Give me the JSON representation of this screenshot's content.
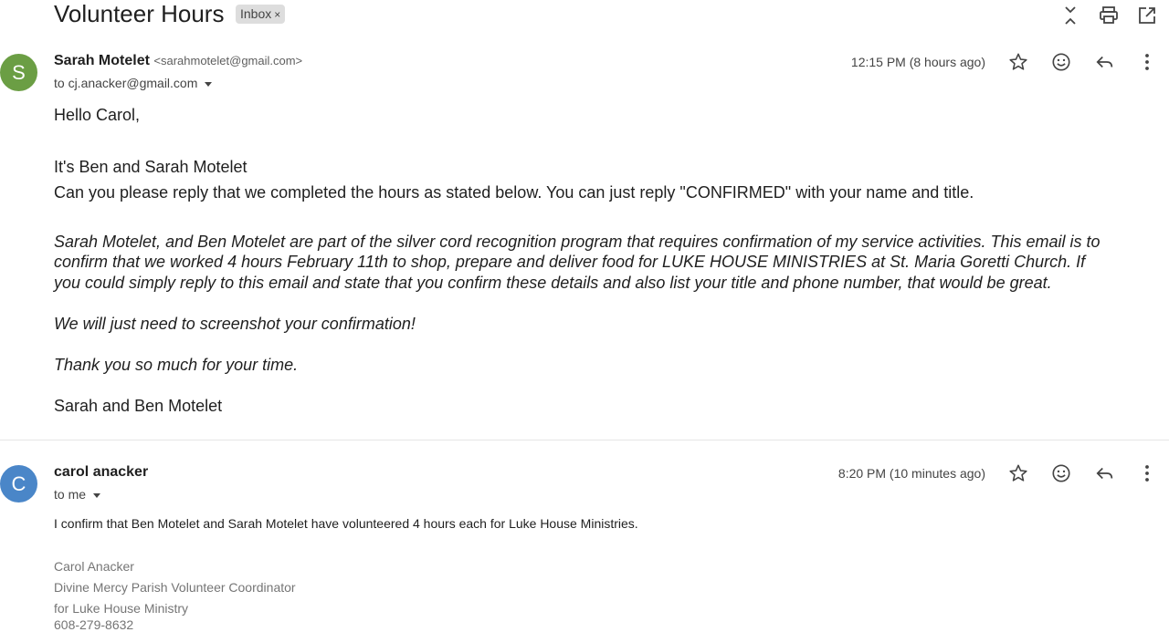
{
  "thread": {
    "subject": "Volunteer Hours",
    "label": "Inbox",
    "label_remove": "×"
  },
  "top_actions": [
    {
      "name": "collapse-all-icon"
    },
    {
      "name": "print-icon"
    },
    {
      "name": "open-in-new-window-icon"
    }
  ],
  "messages": [
    {
      "avatar_letter": "S",
      "avatar_color": "#6b9e44",
      "sender_name": "Sarah Motelet",
      "sender_email": "<sarahmotelet@gmail.com>",
      "to": "to cj.anacker@gmail.com",
      "timestamp": "12:15 PM (8 hours ago)",
      "greeting": "Hello Carol,",
      "line1": "It's Ben and Sarah Motelet",
      "line2": "Can you please reply that we completed the hours as stated below.   You can just reply \"CONFIRMED\" with your name and title.",
      "para1_l1": "Sarah Motelet, and Ben Motelet are part of the silver cord recognition program that requires confirmation of my service activities. This email is to",
      "para1_l2": "confirm that we worked 4 hours February 11th  to shop, prepare and deliver food for LUKE HOUSE MINISTRIES at St. Maria Goretti Church.   If",
      "para1_l3": "you could simply reply to this email and state that you confirm these details and also list your title and phone number, that would be great.",
      "para2": "We will just need to screenshot your confirmation!",
      "para3": "Thank you so much for your time.",
      "signoff": "Sarah and Ben Motelet"
    },
    {
      "avatar_letter": "C",
      "avatar_color": "#4a86c8",
      "sender_name": "carol anacker",
      "to": "to me",
      "timestamp": "8:20 PM (10 minutes ago)",
      "body": "I confirm that Ben Motelet and Sarah Motelet have volunteered 4 hours each for Luke House Ministries.",
      "signature": [
        "Carol Anacker",
        "Divine Mercy Parish Volunteer Coordinator",
        "for Luke House Ministry",
        "608-279-8632"
      ]
    }
  ],
  "message_actions": [
    "star-icon",
    "emoji-reaction-icon",
    "reply-icon",
    "more-options-icon"
  ]
}
